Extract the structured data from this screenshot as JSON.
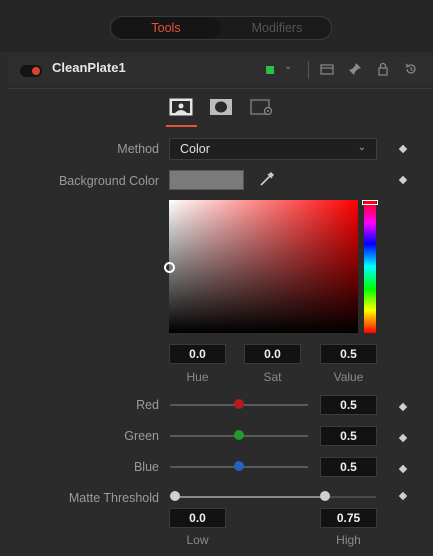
{
  "tabs": [
    {
      "label": "Tools"
    },
    {
      "label": "Modifiers"
    }
  ],
  "tool": {
    "name": "CleanPlate1",
    "color_swatch": "#2bbf4a"
  },
  "controls": {
    "method": {
      "label": "Method",
      "value": "Color"
    },
    "background_color": {
      "label": "Background Color",
      "swatch": "#7b7b7b"
    },
    "hsv": {
      "hue": {
        "value": "0.0",
        "label": "Hue"
      },
      "sat": {
        "value": "0.0",
        "label": "Sat"
      },
      "value": {
        "value": "0.5",
        "label": "Value"
      }
    },
    "red": {
      "label": "Red",
      "value": "0.5",
      "level": 0.5,
      "color": "#b51b1b"
    },
    "green": {
      "label": "Green",
      "value": "0.5",
      "level": 0.5,
      "color": "#1f9a2c"
    },
    "blue": {
      "label": "Blue",
      "value": "0.5",
      "level": 0.5,
      "color": "#2a5fc4"
    },
    "matte_threshold": {
      "label": "Matte Threshold",
      "low": {
        "value": "0.0",
        "label": "Low"
      },
      "high": {
        "value": "0.75",
        "label": "High"
      }
    }
  },
  "colors": {
    "accent": "#e8513a",
    "panel": "#2b2b2b"
  }
}
